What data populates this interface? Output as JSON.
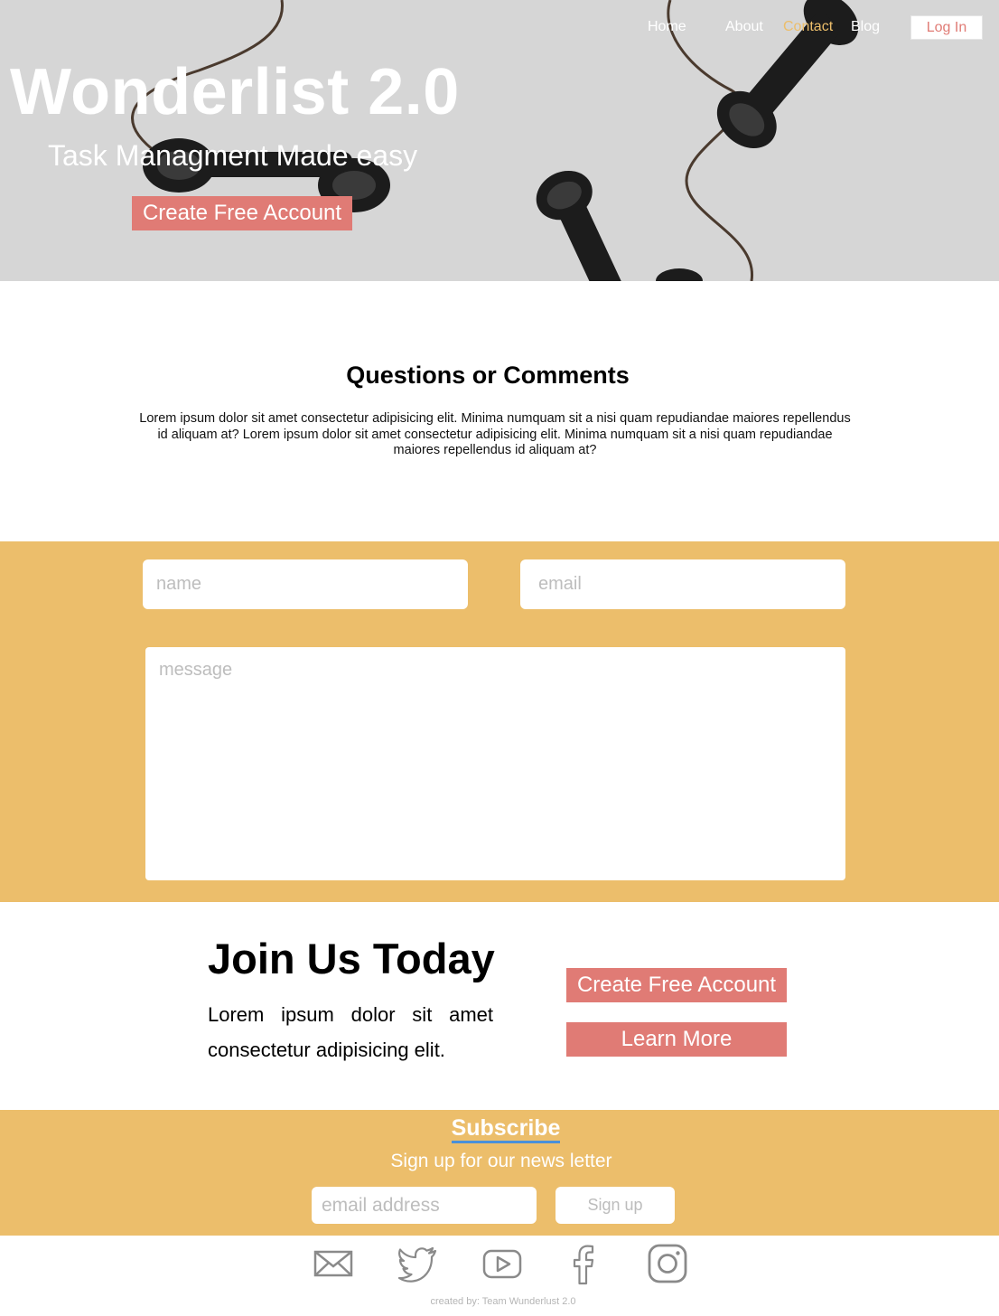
{
  "nav": {
    "items": [
      {
        "label": "Home"
      },
      {
        "label": "About"
      },
      {
        "label": "Contact"
      },
      {
        "label": "Blog"
      }
    ],
    "login_label": "Log In"
  },
  "hero": {
    "title": "Wonderlist 2.0",
    "subtitle": "Task Managment Made easy",
    "cta_label": "Create Free Account"
  },
  "questions": {
    "title": "Questions or Comments",
    "body": "Lorem ipsum dolor sit amet consectetur adipisicing elit. Minima numquam sit a nisi quam repudiandae maiores repellendus id aliquam at? Lorem ipsum dolor sit amet consectetur adipisicing elit. Minima numquam sit a nisi quam repudiandae maiores repellendus id aliquam at?"
  },
  "contact_form": {
    "name_placeholder": "name",
    "email_placeholder": "email",
    "message_placeholder": "message"
  },
  "join": {
    "title": "Join Us Today",
    "text": "Lorem ipsum dolor sit amet consectetur adipisicing elit.",
    "create_label": "Create Free Account",
    "learn_label": "Learn More"
  },
  "subscribe": {
    "title": "Subscribe",
    "text": "Sign up for our news letter",
    "email_placeholder": "email address",
    "button_label": "Sign up"
  },
  "footer": {
    "icons": [
      "mail-icon",
      "twitter-icon",
      "youtube-icon",
      "facebook-icon",
      "instagram-icon"
    ],
    "credit": "created by:  Team Wunderlust 2.0"
  },
  "colors": {
    "accent_yellow": "#ecbe6b",
    "accent_coral": "#e07b75",
    "hero_bg": "#d6d6d6"
  }
}
